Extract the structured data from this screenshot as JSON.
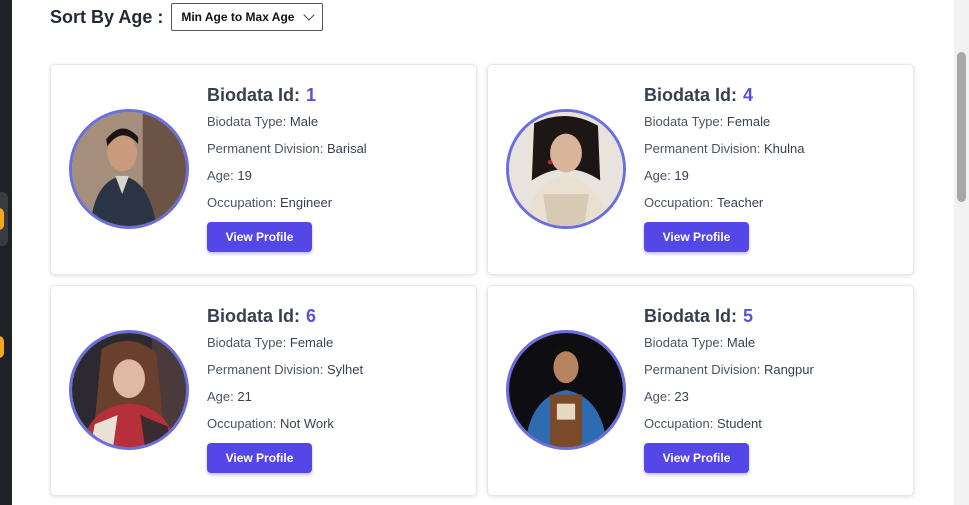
{
  "sort": {
    "label": "Sort By Age :",
    "selected": "Min Age to Max Age"
  },
  "fields": {
    "id_label": "Biodata Id:",
    "type_label": "Biodata Type:",
    "division_label": "Permanent Division:",
    "age_label": "Age:",
    "occupation_label": "Occupation:",
    "button_label": "View Profile"
  },
  "cards": [
    {
      "id": "1",
      "type": "Male",
      "division": "Barisal",
      "age": "19",
      "occupation": "Engineer"
    },
    {
      "id": "4",
      "type": "Female",
      "division": "Khulna",
      "age": "19",
      "occupation": "Teacher"
    },
    {
      "id": "6",
      "type": "Female",
      "division": "Sylhet",
      "age": "21",
      "occupation": "Not Work"
    },
    {
      "id": "5",
      "type": "Male",
      "division": "Rangpur",
      "age": "23",
      "occupation": "Student"
    }
  ],
  "colors": {
    "accent": "#5546e8",
    "avatar_border": "#6a6fe0"
  }
}
